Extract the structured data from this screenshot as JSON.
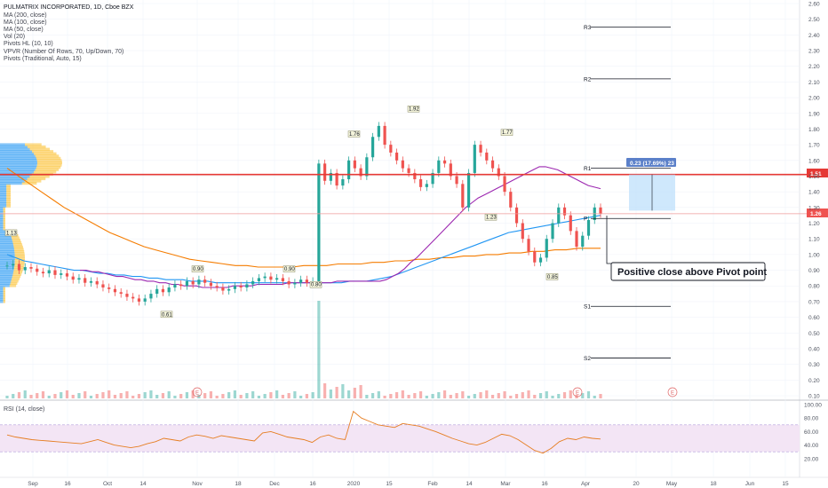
{
  "header": {
    "title": "PULMATRIX INCORPORATED, 1D, Cboe BZX",
    "studies": [
      "MA (200, close)",
      "MA (100, close)",
      "MA (50, close)",
      "Vol (20)",
      "Pivots HL (10, 10)",
      "VPVR (Number Of Rows, 70, Up/Down, 70)",
      "Pivots (Traditional, Auto, 15)"
    ]
  },
  "colors": {
    "up": "#26a69a",
    "down": "#ef5350",
    "ma50": "#9c27b0",
    "ma100": "#2196f3",
    "ma200": "#f57c00",
    "resistance": "#e53935",
    "rsi": "#e67e22",
    "rsi_band": "#f3e5f5",
    "vpvr_up": "#2196f3",
    "vpvr_down": "#fbc02d",
    "measure_box": "#bbdefb",
    "measure_tag": "#5b80c9"
  },
  "price_scale": {
    "ticks": [
      "2.60",
      "2.50",
      "2.40",
      "2.30",
      "2.20",
      "2.10",
      "2.00",
      "1.90",
      "1.80",
      "1.70",
      "1.60",
      "1.50",
      "1.40",
      "1.30",
      "1.20",
      "1.10",
      "1.00",
      "0.90",
      "0.80",
      "0.70",
      "0.60",
      "0.50",
      "0.40",
      "0.30",
      "0.20",
      "0.10"
    ],
    "tag_resistance": "1.51",
    "tag_last": "1.26"
  },
  "date_axis": [
    "Sep",
    "16",
    "Oct",
    "14",
    "Nov",
    "18",
    "Dec",
    "16",
    "2020",
    "15",
    "Feb",
    "14",
    "Mar",
    "16",
    "Apr",
    "20",
    "May",
    "18",
    "Jun",
    "15"
  ],
  "rsi": {
    "label": "RSI (14, close)",
    "ticks": [
      "100.00",
      "80.00",
      "60.00",
      "40.00",
      "20.00"
    ]
  },
  "pivots": {
    "labels": [
      "R3",
      "R2",
      "R1",
      "P",
      "S1",
      "S2"
    ]
  },
  "pivot_hl_labels": [
    "1.13",
    "0.61",
    "0.90",
    "0.90",
    "0.80",
    "1.76",
    "1.92",
    "1.77",
    "1.23",
    "0.85"
  ],
  "earnings_marker": "E",
  "measure_label": "0.23 (17.69%) 23",
  "annotation": "Positive close above Pivot point",
  "chart_data": {
    "type": "candlestick",
    "title": "PULMATRIX INCORPORATED, 1D, Cboe BZX",
    "y_range": [
      0.05,
      2.62
    ],
    "x_labels": [
      "Sep",
      "16",
      "Oct",
      "14",
      "Nov",
      "18",
      "Dec",
      "16",
      "2020",
      "15",
      "Feb",
      "14",
      "Mar",
      "16",
      "Apr",
      "20",
      "May",
      "18",
      "Jun",
      "15"
    ],
    "horizontal_levels": {
      "resistance": 1.51,
      "last_close": 1.26,
      "R3": 2.45,
      "R2": 2.12,
      "R1": 1.55,
      "P": 1.23,
      "S1": 0.67,
      "S2": 0.34
    },
    "close_series": [
      0.93,
      0.94,
      0.9,
      0.92,
      0.91,
      0.89,
      0.88,
      0.9,
      0.87,
      0.88,
      0.86,
      0.84,
      0.85,
      0.82,
      0.83,
      0.81,
      0.79,
      0.78,
      0.76,
      0.75,
      0.73,
      0.72,
      0.7,
      0.72,
      0.75,
      0.78,
      0.76,
      0.79,
      0.81,
      0.8,
      0.83,
      0.81,
      0.84,
      0.82,
      0.8,
      0.79,
      0.77,
      0.78,
      0.8,
      0.79,
      0.81,
      0.83,
      0.85,
      0.86,
      0.84,
      0.85,
      0.83,
      0.81,
      0.82,
      0.84,
      0.82,
      0.83,
      1.58,
      1.47,
      1.52,
      1.44,
      1.48,
      1.6,
      1.55,
      1.5,
      1.62,
      1.75,
      1.82,
      1.7,
      1.65,
      1.6,
      1.55,
      1.52,
      1.48,
      1.43,
      1.45,
      1.52,
      1.6,
      1.58,
      1.5,
      1.45,
      1.3,
      1.52,
      1.7,
      1.65,
      1.6,
      1.55,
      1.5,
      1.4,
      1.3,
      1.2,
      1.1,
      1.02,
      0.95,
      0.98,
      1.1,
      1.2,
      1.3,
      1.25,
      1.15,
      1.05,
      1.12,
      1.22,
      1.3,
      1.26
    ],
    "ma50": [
      0.9,
      0.9,
      0.89,
      0.89,
      0.88,
      0.87,
      0.86,
      0.86,
      0.85,
      0.84,
      0.84,
      0.83,
      0.83,
      0.82,
      0.82,
      0.81,
      0.81,
      0.8,
      0.8,
      0.8,
      0.79,
      0.79,
      0.79,
      0.79,
      0.79,
      0.8,
      0.8,
      0.8,
      0.8,
      0.81,
      0.81,
      0.81,
      0.81,
      0.81,
      0.82,
      0.82,
      0.82,
      0.82,
      0.82,
      0.82,
      0.82,
      0.82,
      0.83,
      0.83,
      0.83,
      0.83,
      0.83,
      0.83,
      0.83,
      0.83,
      0.84,
      0.86,
      0.88,
      0.91,
      0.95,
      0.98,
      1.02,
      1.06,
      1.1,
      1.14,
      1.18,
      1.22,
      1.26,
      1.3,
      1.33,
      1.36,
      1.38,
      1.4,
      1.42,
      1.44,
      1.46,
      1.48,
      1.5,
      1.52,
      1.54,
      1.56,
      1.56,
      1.55,
      1.54,
      1.52,
      1.5,
      1.48,
      1.46,
      1.44,
      1.43,
      1.42
    ],
    "ma100": [
      1.0,
      0.98,
      0.96,
      0.95,
      0.94,
      0.93,
      0.92,
      0.91,
      0.9,
      0.9,
      0.89,
      0.88,
      0.88,
      0.87,
      0.87,
      0.86,
      0.86,
      0.85,
      0.85,
      0.84,
      0.84,
      0.84,
      0.83,
      0.83,
      0.83,
      0.82,
      0.82,
      0.82,
      0.82,
      0.82,
      0.82,
      0.82,
      0.82,
      0.82,
      0.82,
      0.82,
      0.82,
      0.82,
      0.82,
      0.82,
      0.82,
      0.83,
      0.83,
      0.83,
      0.84,
      0.85,
      0.86,
      0.88,
      0.9,
      0.92,
      0.94,
      0.96,
      0.98,
      1.0,
      1.02,
      1.04,
      1.06,
      1.08,
      1.1,
      1.12,
      1.14,
      1.15,
      1.16,
      1.17,
      1.18,
      1.19,
      1.2,
      1.21,
      1.22,
      1.23,
      1.24,
      1.25
    ],
    "ma200": [
      1.55,
      1.5,
      1.45,
      1.4,
      1.35,
      1.3,
      1.26,
      1.22,
      1.18,
      1.14,
      1.11,
      1.08,
      1.05,
      1.03,
      1.01,
      0.99,
      0.97,
      0.96,
      0.95,
      0.94,
      0.93,
      0.93,
      0.92,
      0.92,
      0.92,
      0.92,
      0.93,
      0.93,
      0.93,
      0.94,
      0.94,
      0.94,
      0.95,
      0.95,
      0.96,
      0.96,
      0.97,
      0.97,
      0.98,
      0.98,
      0.99,
      0.99,
      1.0,
      1.0,
      1.01,
      1.01,
      1.02,
      1.02,
      1.03,
      1.03,
      1.04,
      1.04,
      1.04
    ],
    "rsi_series": [
      55,
      52,
      50,
      48,
      47,
      46,
      45,
      44,
      43,
      42,
      45,
      48,
      44,
      40,
      38,
      36,
      38,
      42,
      45,
      50,
      48,
      46,
      52,
      55,
      53,
      50,
      54,
      52,
      50,
      48,
      46,
      58,
      60,
      56,
      52,
      50,
      48,
      44,
      52,
      55,
      50,
      48,
      90,
      80,
      75,
      70,
      68,
      66,
      72,
      70,
      68,
      64,
      60,
      55,
      50,
      46,
      42,
      40,
      44,
      50,
      56,
      54,
      48,
      40,
      32,
      28,
      35,
      45,
      50,
      48,
      52,
      50,
      49
    ],
    "rsi_band": [
      30,
      70
    ],
    "volume_spike_date": "2020"
  }
}
